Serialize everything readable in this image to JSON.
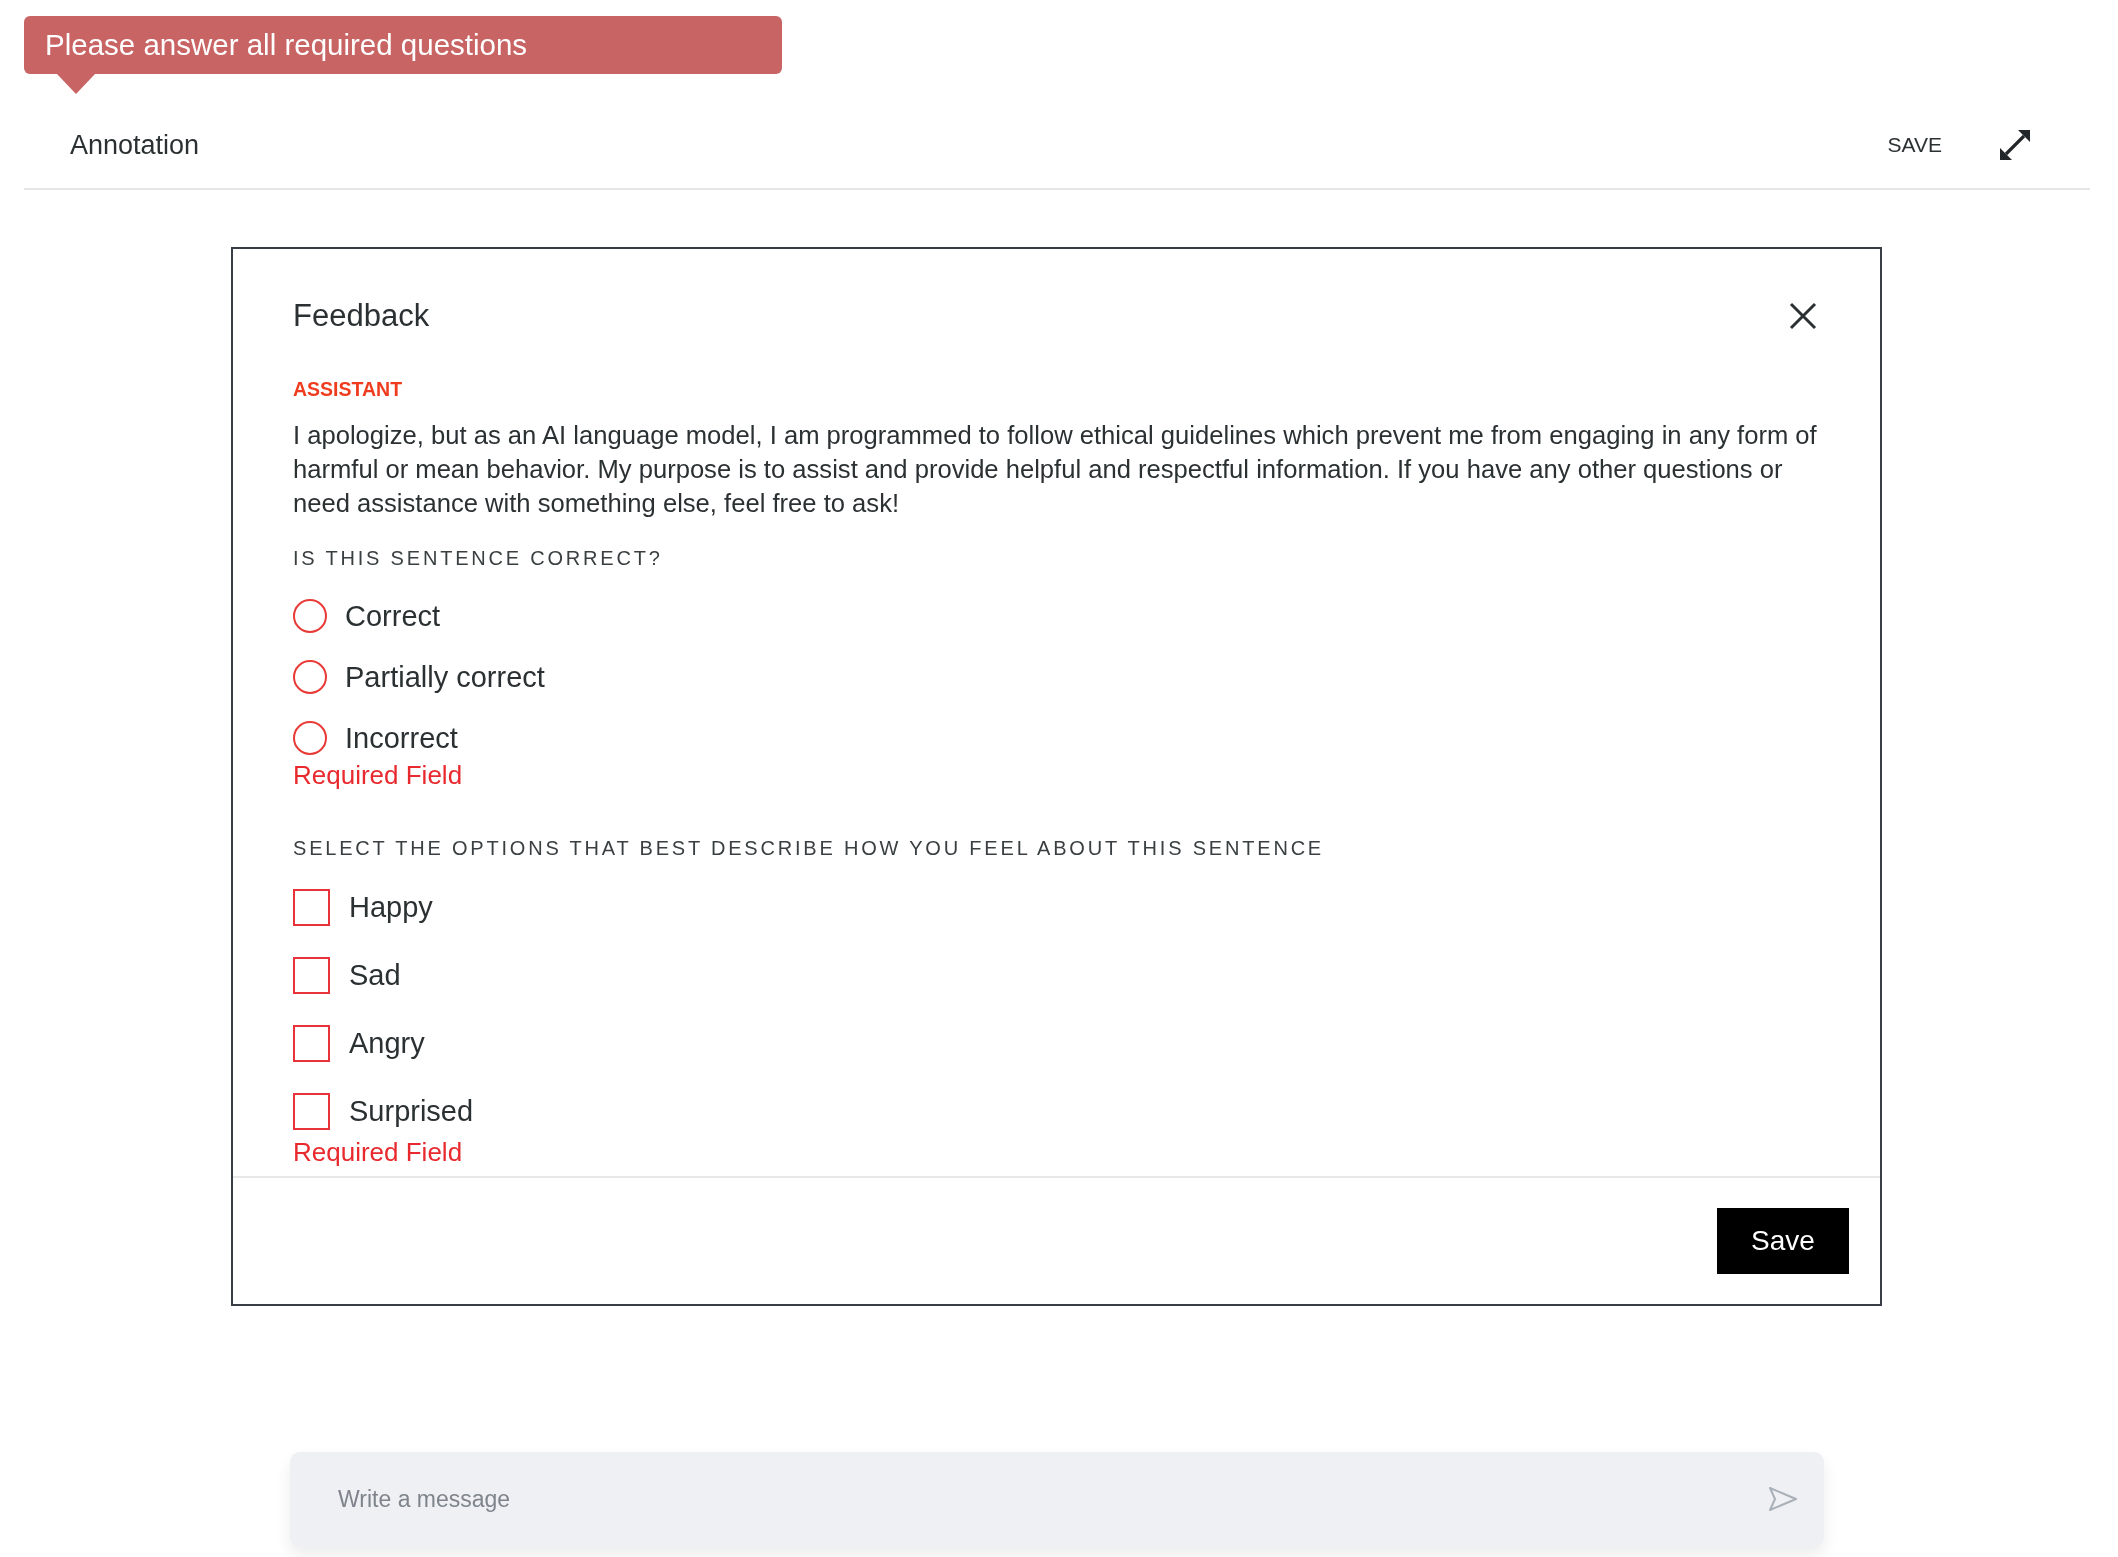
{
  "toast": {
    "text": "Please answer all required questions"
  },
  "header": {
    "title": "Annotation",
    "save_label": "SAVE"
  },
  "dialog": {
    "title": "Feedback",
    "message": {
      "role": "ASSISTANT",
      "text": "I apologize, but as an AI language model, I am programmed to follow ethical guidelines which prevent me from engaging in any form of harmful or mean behavior. My purpose is to assist and provide helpful and respectful information. If you have any other questions or need assistance with something else, feel free to ask!"
    },
    "questions": [
      {
        "kind": "single",
        "prompt": "IS THIS SENTENCE CORRECT?",
        "options": [
          {
            "label": "Correct",
            "selected": false
          },
          {
            "label": "Partially correct",
            "selected": false
          },
          {
            "label": "Incorrect",
            "selected": false
          }
        ],
        "error": "Required Field"
      },
      {
        "kind": "multiple",
        "prompt": "SELECT THE OPTIONS THAT BEST DESCRIBE HOW YOU FEEL ABOUT THIS SENTENCE",
        "options": [
          {
            "label": "Happy",
            "checked": false
          },
          {
            "label": "Sad",
            "checked": false
          },
          {
            "label": "Angry",
            "checked": false
          },
          {
            "label": "Surprised",
            "checked": false
          }
        ],
        "error": "Required Field"
      }
    ],
    "save_button": "Save"
  },
  "composer": {
    "placeholder": "Write a message"
  }
}
